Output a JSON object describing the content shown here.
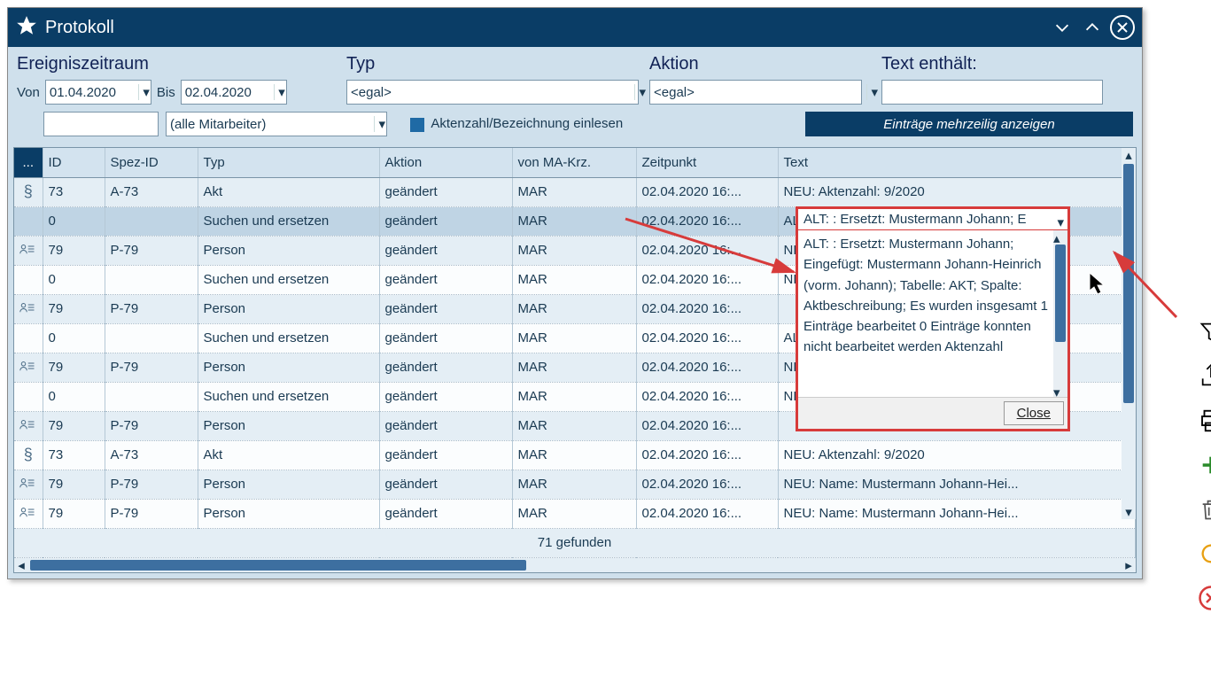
{
  "titlebar": {
    "title": "Protokoll"
  },
  "filters": {
    "ereigniszeitraum_label": "Ereigniszeitraum",
    "typ_label": "Typ",
    "aktion_label": "Aktion",
    "text_label": "Text enthält:",
    "von_label": "Von",
    "bis_label": "Bis",
    "von_value": "01.04.2020",
    "bis_value": "02.04.2020",
    "typ_value": "<egal>",
    "aktion_value": "<egal>",
    "text_value": "",
    "mitarbeiter_value": "(alle Mitarbeiter)",
    "aktenzahl_chk_label": "Aktenzahl/Bezeichnung einlesen",
    "mehrzeilig_btn": "Einträge mehrzeilig anzeigen",
    "search_value": ""
  },
  "columns": {
    "icon": "...",
    "id": "ID",
    "spez": "Spez-ID",
    "typ": "Typ",
    "aktion": "Aktion",
    "ma": "von MA-Krz.",
    "zeitpunkt": "Zeitpunkt",
    "text": "Text"
  },
  "rows": [
    {
      "icon": "§",
      "id": "73",
      "spez": "A-73",
      "typ": "Akt",
      "aktion": "geändert",
      "ma": "MAR",
      "zp": "02.04.2020 16:...",
      "text": "NEU:   Aktenzahl: 9/2020",
      "odd": true
    },
    {
      "icon": "",
      "id": "0",
      "spez": "",
      "typ": "Suchen und ersetzen",
      "aktion": "geändert",
      "ma": "MAR",
      "zp": "02.04.2020 16:...",
      "text": "ALT:   : Ersetzt: Mustermann Johann; E...",
      "odd": false,
      "selected": true
    },
    {
      "icon": "P",
      "id": "79",
      "spez": "P-79",
      "typ": "Person",
      "aktion": "geändert",
      "ma": "MAR",
      "zp": "02.04.2020 16:...",
      "text": "NEU:   Name: Mustermann Johann-Hei...",
      "odd": true
    },
    {
      "icon": "",
      "id": "0",
      "spez": "",
      "typ": "Suchen und ersetzen",
      "aktion": "geändert",
      "ma": "MAR",
      "zp": "02.04.2020 16:...",
      "text": "NEU:   Name: Mustermann Johann-H...",
      "odd": false
    },
    {
      "icon": "P",
      "id": "79",
      "spez": "P-79",
      "typ": "Person",
      "aktion": "geändert",
      "ma": "MAR",
      "zp": "02.04.2020 16:...",
      "text": "",
      "odd": true
    },
    {
      "icon": "",
      "id": "0",
      "spez": "",
      "typ": "Suchen und ersetzen",
      "aktion": "geändert",
      "ma": "MAR",
      "zp": "02.04.2020 16:...",
      "text": "ALT:   : Ersetzt: Mustermann Johann; E...",
      "odd": false
    },
    {
      "icon": "P",
      "id": "79",
      "spez": "P-79",
      "typ": "Person",
      "aktion": "geändert",
      "ma": "MAR",
      "zp": "02.04.2020 16:...",
      "text": "NEU:   Name: Mustermann Johann-Hei...",
      "odd": true
    },
    {
      "icon": "",
      "id": "0",
      "spez": "",
      "typ": "Suchen und ersetzen",
      "aktion": "geändert",
      "ma": "MAR",
      "zp": "02.04.2020 16:...",
      "text": "NEU:   Name: Mustermann Johann-H...",
      "odd": false
    },
    {
      "icon": "P",
      "id": "79",
      "spez": "P-79",
      "typ": "Person",
      "aktion": "geändert",
      "ma": "MAR",
      "zp": "02.04.2020 16:...",
      "text": "",
      "odd": true
    },
    {
      "icon": "§",
      "id": "73",
      "spez": "A-73",
      "typ": "Akt",
      "aktion": "geändert",
      "ma": "MAR",
      "zp": "02.04.2020 16:...",
      "text": "NEU:   Aktenzahl: 9/2020",
      "odd": false
    },
    {
      "icon": "P",
      "id": "79",
      "spez": "P-79",
      "typ": "Person",
      "aktion": "geändert",
      "ma": "MAR",
      "zp": "02.04.2020 16:...",
      "text": "NEU:   Name: Mustermann Johann-Hei...",
      "odd": true
    },
    {
      "icon": "P",
      "id": "79",
      "spez": "P-79",
      "typ": "Person",
      "aktion": "geändert",
      "ma": "MAR",
      "zp": "02.04.2020 16:...",
      "text": "NEU:   Name: Mustermann Johann-Hei...",
      "odd": false
    }
  ],
  "summary": "71 gefunden",
  "popup": {
    "preview": "ALT:   : Ersetzt: Mustermann Johann; E",
    "full_text": "ALT:   : Ersetzt: Mustermann Johann; Eingefügt: Mustermann Johann-Heinrich (vorm. Johann);  Tabelle: AKT; Spalte: Aktbeschreibung;  Es wurden insgesamt 1 Einträge bearbeitet 0 Einträge konnten nicht bearbeitet werden  Aktenzahl",
    "close_label": "Close"
  },
  "side_tools": {
    "filter": "filter",
    "export": "export",
    "print": "print",
    "add": "add",
    "delete": "delete",
    "refresh": "refresh",
    "cancel": "cancel"
  }
}
